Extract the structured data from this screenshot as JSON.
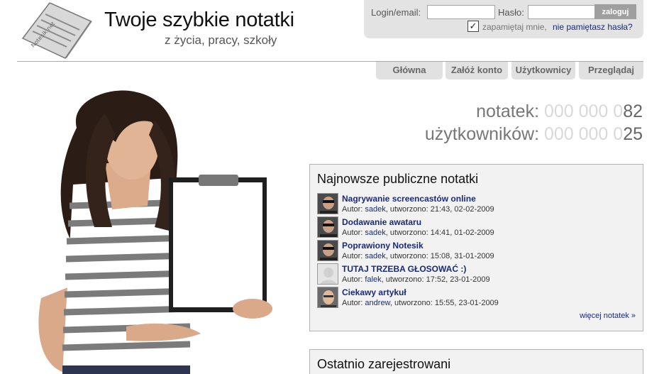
{
  "header": {
    "title": "Twoje szybkie notatki",
    "tagline": "z życia, pracy, szkoły",
    "logo_text": "Notesik.net"
  },
  "login": {
    "login_label": "Login/email:",
    "password_label": "Hasło:",
    "submit_label": "zaloguj",
    "remember_label": "zapamiętaj mnie,",
    "remember_checked": true,
    "forgot_label": "nie pamiętasz hasła?"
  },
  "nav": {
    "tabs": [
      {
        "label": "Główna"
      },
      {
        "label": "Załóż konto"
      },
      {
        "label": "Użytkownicy"
      },
      {
        "label": "Przeglądaj"
      }
    ]
  },
  "stats": {
    "notes_label": "notatek:",
    "notes_dim": "000 000 0",
    "notes_lit": "82",
    "users_label": "użytkowników:",
    "users_dim": "000 000 0",
    "users_lit": "25"
  },
  "latest": {
    "title": "Najnowsze publiczne notatki",
    "author_prefix": "Autor:",
    "created_prefix": ", utworzono:",
    "items": [
      {
        "title": "Nagrywanie screencastów online",
        "author": "sadek",
        "date": "21:43, 02-02-2009"
      },
      {
        "title": "Dodawanie awataru",
        "author": "sadek",
        "date": "14:41, 01-02-2009"
      },
      {
        "title": "Poprawiony Notesik",
        "author": "sadek",
        "date": "15:08, 31-01-2009"
      },
      {
        "title": "TUTAJ TRZEBA GŁOSOWAĆ :)",
        "author": "falek",
        "date": "17:52, 23-01-2009"
      },
      {
        "title": "Ciekawy artykuł",
        "author": "andrew",
        "date": "15:55, 23-01-2009"
      }
    ],
    "more_label": "więcej notatek »"
  },
  "recent": {
    "title": "Ostatnio zarejestrowani"
  },
  "colors": {
    "link": "#1a2a7a",
    "panel_bg": "#f2f2f2",
    "tab_bg": "#e1e1e1",
    "login_bg": "#e3e3e3"
  }
}
